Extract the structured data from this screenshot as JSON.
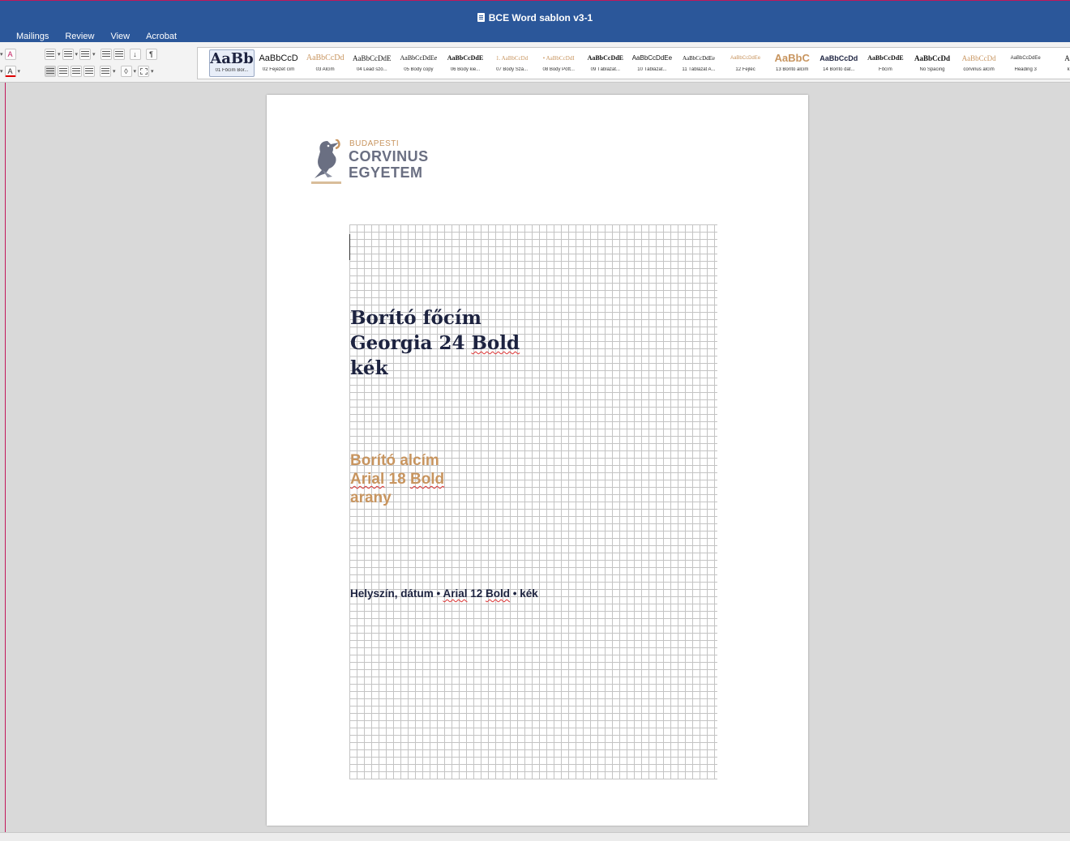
{
  "window": {
    "title": "BCE Word sablon v3-1"
  },
  "menu": [
    "Mailings",
    "Review",
    "View",
    "Acrobat"
  ],
  "styles": [
    {
      "sample": "AaBb",
      "label": "01 Főcím Bor...",
      "font": "DejaVu Serif",
      "size": "18px",
      "weight": "bold",
      "color": "#1d2340",
      "selected": true
    },
    {
      "sample": "AaBbCcD",
      "label": "02 Fejezet cím",
      "font": "Liberation Sans",
      "size": "11px",
      "weight": "normal",
      "color": "#111111"
    },
    {
      "sample": "AaBbCcDd",
      "label": "03 Alcím",
      "font": "Liberation Serif",
      "size": "10px",
      "weight": "normal",
      "color": "#c8955f"
    },
    {
      "sample": "AaBbCcDdE",
      "label": "04 Lead szö...",
      "font": "Liberation Serif",
      "size": "9px",
      "weight": "normal",
      "color": "#111111"
    },
    {
      "sample": "AaBbCcDdEe",
      "label": "05 Body copy",
      "font": "Liberation Serif",
      "size": "8px",
      "weight": "normal",
      "color": "#111111"
    },
    {
      "sample": "AaBbCcDdE",
      "label": "06 Body kie...",
      "font": "Liberation Serif",
      "size": "8px",
      "weight": "bold",
      "color": "#111111"
    },
    {
      "sample": "1. AaBbCcDd",
      "label": "07 Body Szá...",
      "font": "Liberation Serif",
      "size": "7px",
      "weight": "normal",
      "color": "#c8955f"
    },
    {
      "sample": "• AaBbCcDdI",
      "label": "08 Body Pött...",
      "font": "Liberation Serif",
      "size": "7px",
      "weight": "normal",
      "color": "#c8955f"
    },
    {
      "sample": "AaBbCcDdE",
      "label": "09 Táblázat...",
      "font": "Liberation Serif",
      "size": "8px",
      "weight": "bold",
      "color": "#111111"
    },
    {
      "sample": "AaBbCcDdEe",
      "label": "10 Táblázat...",
      "font": "Liberation Sans",
      "size": "8px",
      "weight": "normal",
      "color": "#111111"
    },
    {
      "sample": "AaBbCcDdEe",
      "label": "11 Táblázat A...",
      "font": "Liberation Serif",
      "size": "7px",
      "weight": "normal",
      "color": "#111111"
    },
    {
      "sample": "AaBbCcDdEe",
      "label": "12 Fejléc",
      "font": "Liberation Sans",
      "size": "6px",
      "weight": "normal",
      "color": "#c8955f"
    },
    {
      "sample": "AaBbC",
      "label": "13 Borító alcím",
      "font": "Liberation Sans",
      "size": "13px",
      "weight": "bold",
      "color": "#c8955f"
    },
    {
      "sample": "AaBbCcDd",
      "label": "14 Borító dát...",
      "font": "Liberation Sans",
      "size": "9px",
      "weight": "bold",
      "color": "#1d2340"
    },
    {
      "sample": "AaBbCcDdE",
      "label": "Főcím",
      "font": "Liberation Serif",
      "size": "8px",
      "weight": "bold",
      "color": "#111111"
    },
    {
      "sample": "AaBbCcDd",
      "label": "No Spacing",
      "font": "Liberation Serif",
      "size": "9px",
      "weight": "bold",
      "color": "#111111"
    },
    {
      "sample": "AaBbCcDd",
      "label": "corvinus alcím",
      "font": "Liberation Serif",
      "size": "9px",
      "weight": "normal",
      "color": "#c8955f"
    },
    {
      "sample": "AaBbCcDdEe",
      "label": "Heading 3",
      "font": "Liberation Sans",
      "size": "6px",
      "weight": "normal",
      "color": "#333333"
    },
    {
      "sample": "AaBl",
      "label": "kiele",
      "font": "Liberation Serif",
      "size": "9px",
      "weight": "normal",
      "color": "#111111"
    }
  ],
  "logo": {
    "line1": "BUDAPESTI",
    "line2": "CORVINUS",
    "line3": "EGYETEM"
  },
  "doc": {
    "title": [
      "Borító főcím",
      "Georgia 24 Bold",
      "kék"
    ],
    "title_line2_a": "Georgia 24 ",
    "title_line2_b": "Bold",
    "subtitle_line1": "Borító alcím",
    "subtitle_line2_a": "Arial",
    "subtitle_line2_b": " 18 ",
    "subtitle_line2_c": "Bold",
    "subtitle_line3": "arany",
    "location_a": "Helyszín, dátum • ",
    "location_b": "Arial",
    "location_c": " 12 ",
    "location_d": "Bold",
    "location_e": " • kék"
  },
  "colors": {
    "brand_blue": "#1d2340",
    "gold": "#c8955f",
    "word_blue": "#2b579a",
    "logo_grey": "#6a6f82"
  }
}
